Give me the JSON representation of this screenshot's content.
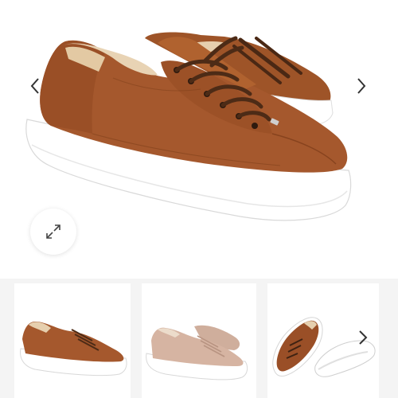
{
  "gallery": {
    "main_image": {
      "name": "main-product-image",
      "colors": {
        "leather": "#a5582d",
        "leather_dark": "#7a3b18",
        "sole": "#ffffff",
        "lace": "#4d2b16",
        "lining": "#e8d3b4"
      }
    },
    "prev_arrow_icon": "chevron-left-icon",
    "next_arrow_icon": "chevron-right-icon",
    "zoom_icon": "expand-icon",
    "thumbnails": [
      {
        "name": "thumbnail-tan-sneaker-side",
        "colors": {
          "upper": "#a5582d",
          "sole": "#ffffff"
        }
      },
      {
        "name": "thumbnail-nude-sneaker-pair",
        "colors": {
          "upper": "#d6b4a2",
          "sole": "#ffffff"
        }
      },
      {
        "name": "thumbnail-tan-sneaker-top-and-sole",
        "colors": {
          "upper": "#9a4f27",
          "sole": "#ffffff"
        }
      }
    ],
    "thumbnail_next_icon": "chevron-right-icon",
    "strip_background": "#f4f4f4"
  }
}
